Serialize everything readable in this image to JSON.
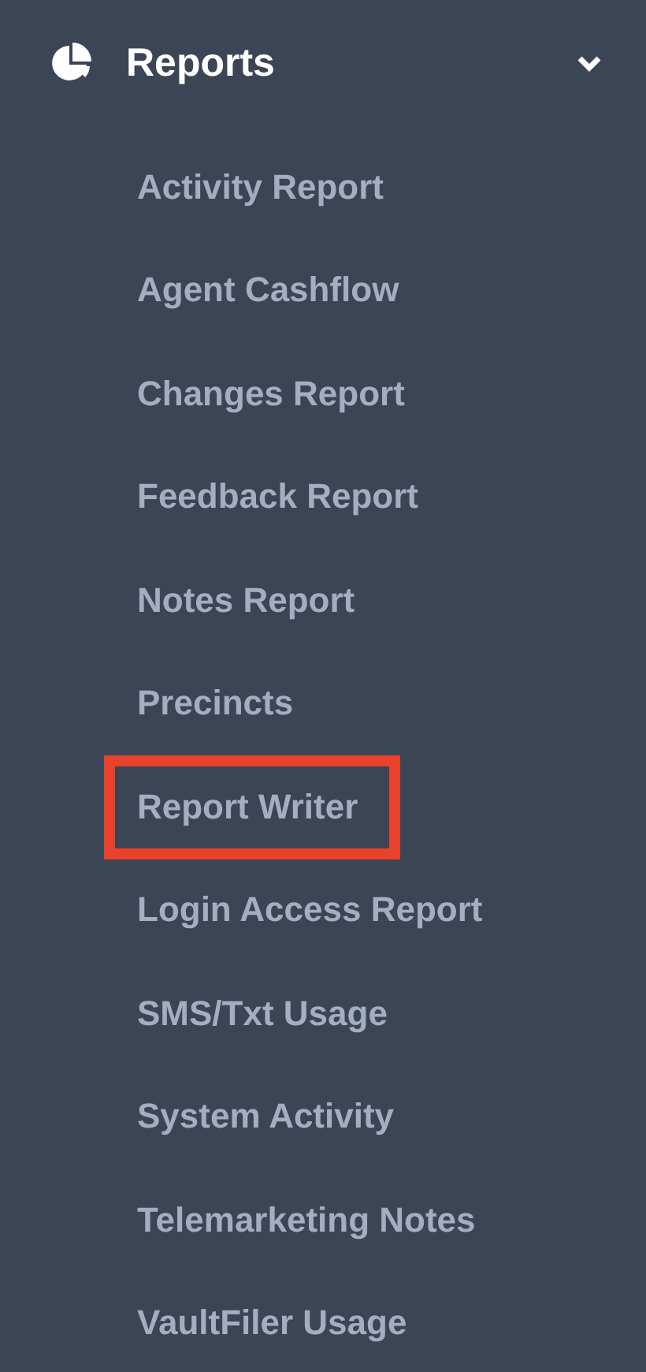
{
  "section": {
    "title": "Reports",
    "expanded": true
  },
  "items": [
    {
      "label": "Activity Report",
      "highlighted": false
    },
    {
      "label": "Agent Cashflow",
      "highlighted": false
    },
    {
      "label": "Changes Report",
      "highlighted": false
    },
    {
      "label": "Feedback Report",
      "highlighted": false
    },
    {
      "label": "Notes Report",
      "highlighted": false
    },
    {
      "label": "Precincts",
      "highlighted": false
    },
    {
      "label": "Report Writer",
      "highlighted": true
    },
    {
      "label": "Login Access Report",
      "highlighted": false
    },
    {
      "label": "SMS/Txt Usage",
      "highlighted": false
    },
    {
      "label": "System Activity",
      "highlighted": false
    },
    {
      "label": "Telemarketing Notes",
      "highlighted": false
    },
    {
      "label": "VaultFiler Usage",
      "highlighted": false
    }
  ]
}
